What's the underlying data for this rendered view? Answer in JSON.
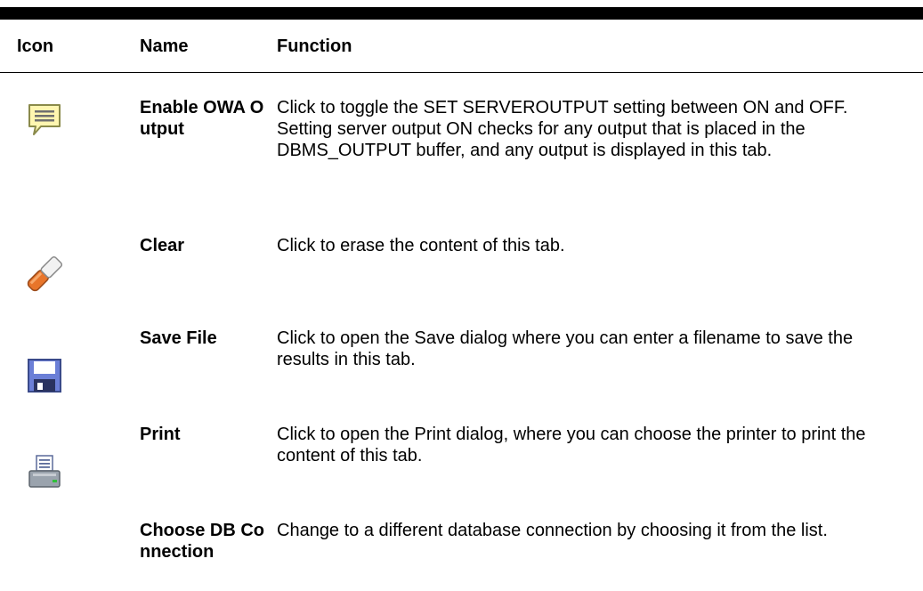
{
  "table": {
    "headers": {
      "icon": "Icon",
      "name": "Name",
      "function": "Function"
    },
    "rows": [
      {
        "icon": "comment-bubble-icon",
        "name": "Enable OWA Output",
        "function": "Click to toggle the SET SERVEROUTPUT setting between ON and OFF. Setting server output ON checks for any output that is placed in the DBMS_OUTPUT buffer, and any output is displayed in this tab."
      },
      {
        "icon": "eraser-icon",
        "name": "Clear",
        "function": "Click to erase the content of this tab."
      },
      {
        "icon": "floppy-disk-icon",
        "name": "Save File",
        "function": "Click to open the Save dialog where you can enter a filename to save the results in this tab."
      },
      {
        "icon": "printer-icon",
        "name": "Print",
        "function": "Click to open the Print dialog, where you can choose the printer to print the content of this tab."
      },
      {
        "icon": "",
        "name": "Choose DB Connection",
        "function": "Change to a different database connection by choosing it from the list."
      }
    ]
  },
  "colors": {
    "rule": "#000000",
    "bubble_fill": "#fff6b0",
    "bubble_stroke": "#8a8a4a",
    "eraser_orange": "#e8752a",
    "floppy_blue": "#6b7fd7",
    "printer_gray": "#9aa3ad"
  }
}
